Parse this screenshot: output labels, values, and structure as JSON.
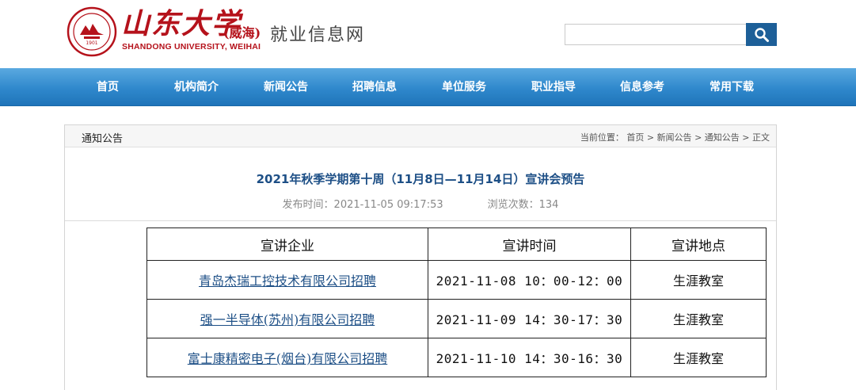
{
  "header": {
    "logo_script": "山东大学",
    "logo_campus": "(威海)",
    "logo_en": "SHANDONG UNIVERSITY,  WEIHAI",
    "seal_year": "1901",
    "site_name": "就业信息网",
    "search": {
      "value": "",
      "placeholder": ""
    },
    "search_icon": "search-icon"
  },
  "nav": {
    "items": [
      {
        "label": "首页"
      },
      {
        "label": "机构简介"
      },
      {
        "label": "新闻公告"
      },
      {
        "label": "招聘信息"
      },
      {
        "label": "单位服务"
      },
      {
        "label": "职业指导"
      },
      {
        "label": "信息参考"
      },
      {
        "label": "常用下载"
      }
    ]
  },
  "panel": {
    "title": "通知公告",
    "breadcrumb": {
      "prefix": "当前位置：",
      "items": [
        "首页",
        "新闻公告",
        "通知公告",
        "正文"
      ],
      "separator": " > "
    }
  },
  "article": {
    "title": "2021年秋季学期第十周（11月8日—11月14日）宣讲会预告",
    "publish_label": "发布时间：2021-11-05 09:17:53",
    "views_label": "浏览次数：134"
  },
  "table": {
    "headers": [
      "宣讲企业",
      "宣讲时间",
      "宣讲地点"
    ],
    "rows": [
      {
        "company": "青岛杰瑞工控技术有限公司招聘",
        "time": "2021-11-08 10：00-12：00",
        "place": "生涯教室"
      },
      {
        "company": "强一半导体(苏州)有限公司招聘",
        "time": "2021-11-09 14：30-17：30",
        "place": "生涯教室"
      },
      {
        "company": "富士康精密电子(烟台)有限公司招聘",
        "time": "2021-11-10 14：30-16：30",
        "place": "生涯教室"
      }
    ]
  },
  "colors": {
    "brand_red": "#b5121b",
    "nav_blue": "#2f88cc",
    "title_blue": "#1d4f86"
  }
}
